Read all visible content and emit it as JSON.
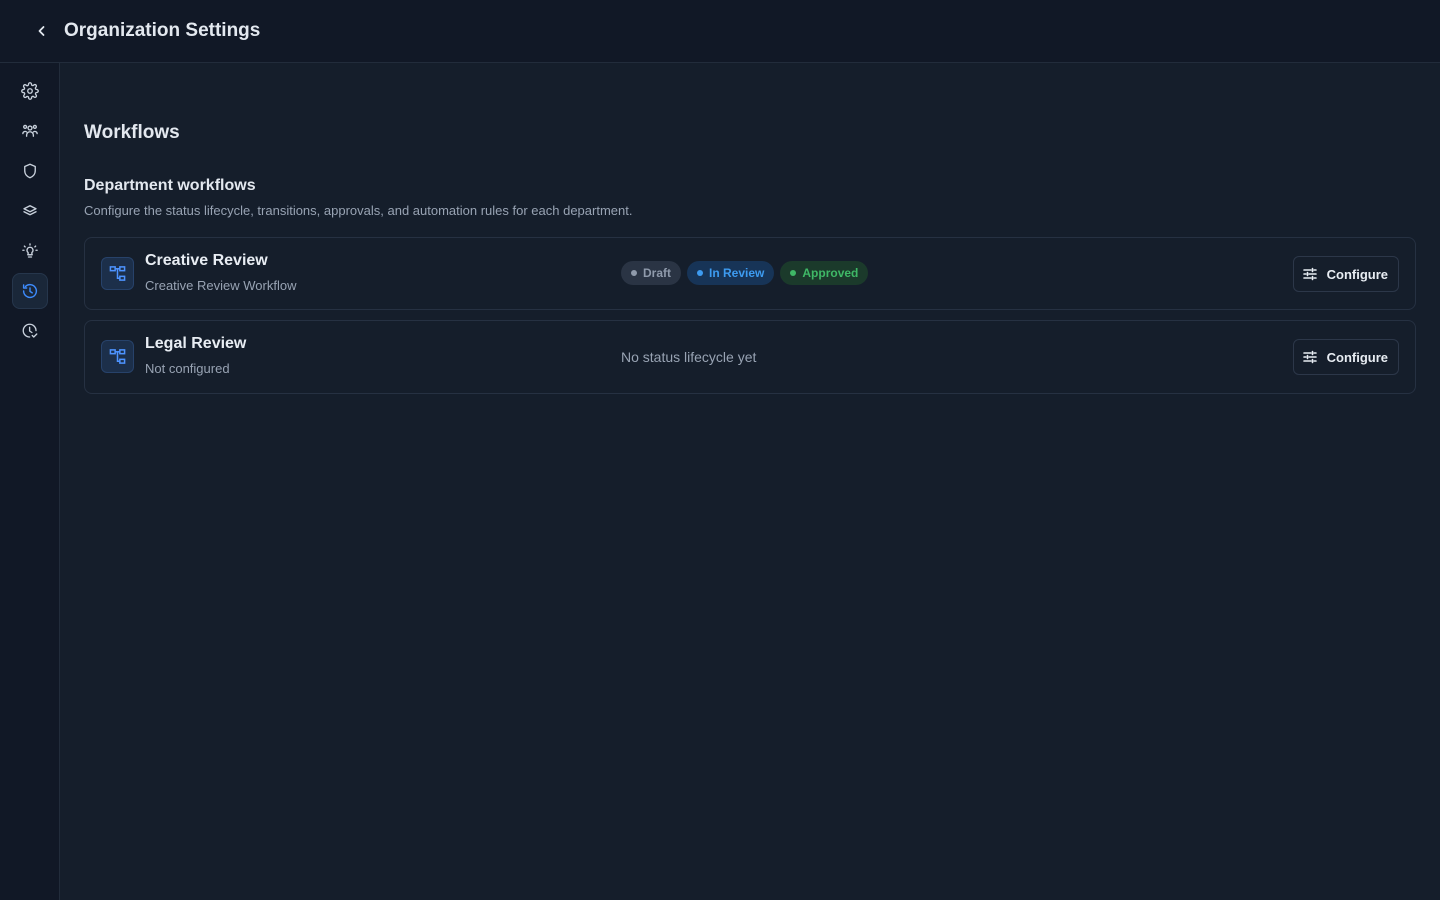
{
  "header": {
    "title": "Organization Settings",
    "back_icon": "chevron-left-icon"
  },
  "sidebar": {
    "items": [
      {
        "icon": "gear-icon",
        "active": false
      },
      {
        "icon": "users-icon",
        "active": false
      },
      {
        "icon": "shield-icon",
        "active": false
      },
      {
        "icon": "layers-icon",
        "active": false
      },
      {
        "icon": "lightbulb-icon",
        "active": false
      },
      {
        "icon": "history-icon",
        "active": true
      },
      {
        "icon": "clock-check-icon",
        "active": false
      }
    ]
  },
  "main": {
    "page_title": "Workflows",
    "section_title": "Department workflows",
    "section_description": "Configure the status lifecycle, transitions, approvals, and automation rules for each department.",
    "workflows": [
      {
        "name": "Creative Review",
        "subtitle": "Creative Review Workflow",
        "icon": "workflow-icon",
        "statuses": [
          {
            "label": "Draft",
            "bg": "#2a3444",
            "fg": "#8f9aab",
            "dot": "#8f9aab"
          },
          {
            "label": "In Review",
            "bg": "#173457",
            "fg": "#3d9bf0",
            "dot": "#3d9bf0"
          },
          {
            "label": "Approved",
            "bg": "#1b3a2b",
            "fg": "#3fb866",
            "dot": "#3fb866"
          }
        ],
        "configure_label": "Configure"
      },
      {
        "name": "Legal Review",
        "subtitle": "Not configured",
        "icon": "workflow-icon",
        "empty_text": "No status lifecycle yet",
        "configure_label": "Configure"
      }
    ]
  },
  "colors": {
    "background": "#151e2b",
    "topbar": "#111826",
    "accent": "#3d8bfd",
    "border": "#263142"
  }
}
